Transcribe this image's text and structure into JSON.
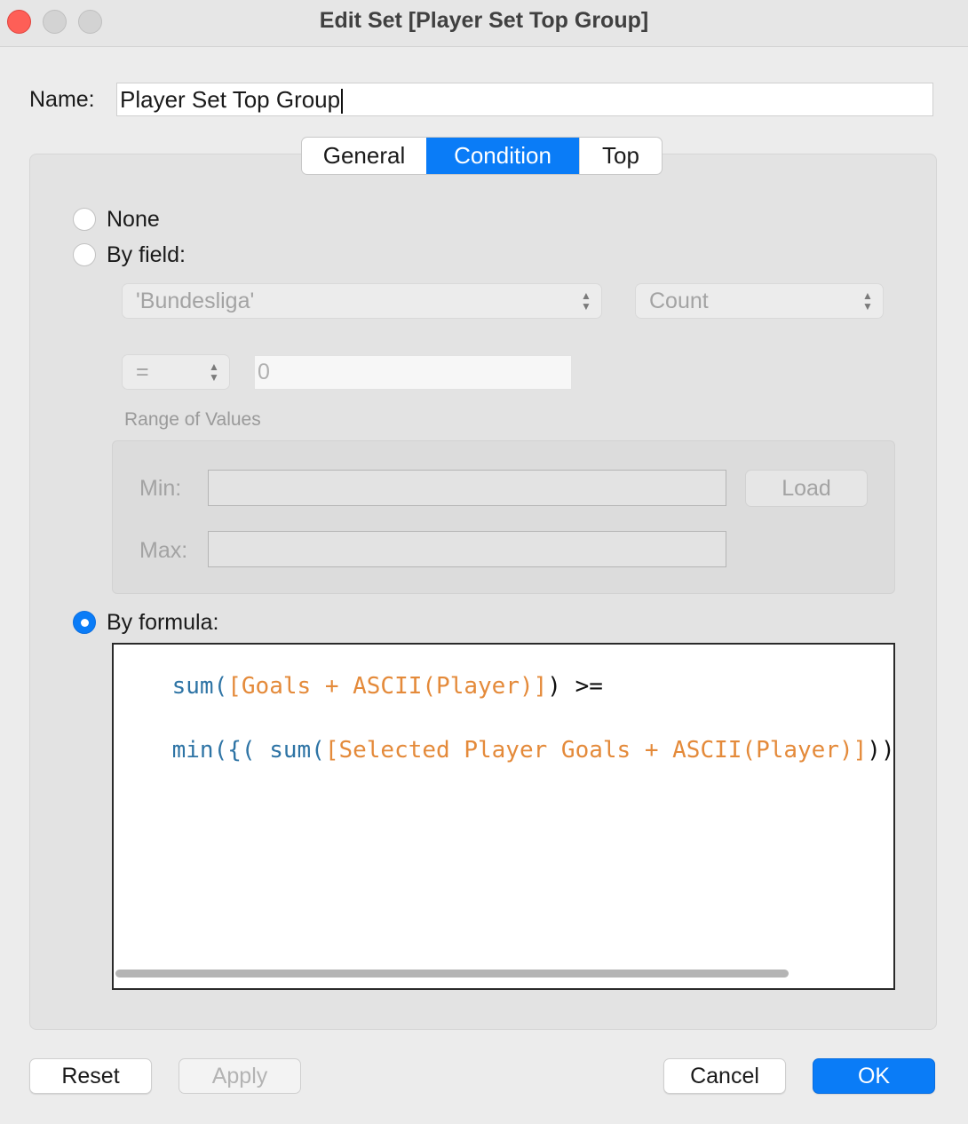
{
  "window": {
    "title": "Edit Set [Player Set Top Group]"
  },
  "name": {
    "label": "Name:",
    "value": "Player Set Top Group"
  },
  "tabs": [
    {
      "label": "General",
      "selected": false
    },
    {
      "label": "Condition",
      "selected": true
    },
    {
      "label": "Top",
      "selected": false
    }
  ],
  "condition": {
    "none_label": "None",
    "by_field_label": "By field:",
    "field_value": "'Bundesliga'",
    "aggregation_value": "Count",
    "operator_value": "=",
    "operand_value": "0",
    "range_label": "Range of Values",
    "min_label": "Min:",
    "max_label": "Max:",
    "min_value": "",
    "max_value": "",
    "load_label": "Load",
    "by_formula_label": "By formula:",
    "selected_option": "by_formula",
    "formula_lines": [
      [
        {
          "t": "sum(",
          "c": "kw"
        },
        {
          "t": "[Goals + ASCII(Player)]",
          "c": "fld"
        },
        {
          "t": ") >=",
          "c": "op"
        }
      ],
      [
        {
          "t": "min({( sum(",
          "c": "kw"
        },
        {
          "t": "[Selected Player Goals + ASCII(Player)]",
          "c": "fld"
        },
        {
          "t": "))",
          "c": "op"
        }
      ]
    ]
  },
  "buttons": {
    "reset": "Reset",
    "apply": "Apply",
    "cancel": "Cancel",
    "ok": "OK"
  },
  "colors": {
    "accent": "#0a7cf7",
    "keyword": "#2e74a5",
    "field": "#e48a3a",
    "close": "#fe5f57"
  }
}
